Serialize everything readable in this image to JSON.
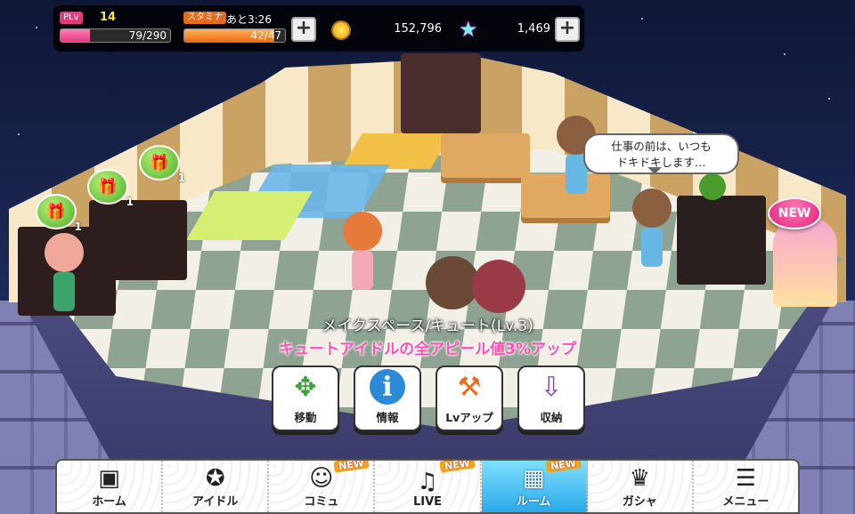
{
  "hud": {
    "plv_label": "PLv",
    "plv_value": "14",
    "exp_text": "79/290",
    "exp_fraction": 0.27,
    "stamina_label": "スタミナ",
    "stamina_timer": "あと3:26",
    "stamina_text": "42/47",
    "stamina_fraction": 0.89,
    "money": "152,796",
    "jewels": "1,469",
    "plus_symbol": "+"
  },
  "room": {
    "speech": "仕事の前は、いつも\nドキドキします…",
    "new_badge": "NEW",
    "gift_counts": [
      "1",
      "1",
      "1"
    ],
    "gift_icon": "gift-icon"
  },
  "item": {
    "name": "メイクスペース/キュート(Lv.3)",
    "effect": "キュートアイドルの全アピール値3%アップ"
  },
  "actions": [
    {
      "label": "移動",
      "icon": "move-arrows-icon",
      "glyph": "✥"
    },
    {
      "label": "情報",
      "icon": "info-icon",
      "glyph": "i"
    },
    {
      "label": "Lvアップ",
      "icon": "hammer-icon",
      "glyph": "⚒"
    },
    {
      "label": "収納",
      "icon": "storage-cart-icon",
      "glyph": "⇩"
    }
  ],
  "nav": {
    "items": [
      {
        "label": "ホーム",
        "icon": "speaker-home-icon",
        "glyph": "▣",
        "new": false
      },
      {
        "label": "アイドル",
        "icon": "idol-star-icon",
        "glyph": "✪",
        "new": false
      },
      {
        "label": "コミュ",
        "icon": "chat-icon",
        "glyph": "☺",
        "new": true
      },
      {
        "label": "LIVE",
        "icon": "music-note-icon",
        "glyph": "♫",
        "new": true
      },
      {
        "label": "ルーム",
        "icon": "room-cube-icon",
        "glyph": "▦",
        "new": true
      },
      {
        "label": "ガシャ",
        "icon": "crown-icon",
        "glyph": "♛",
        "new": false
      },
      {
        "label": "メニュー",
        "icon": "menu-icon",
        "glyph": "☰",
        "new": false
      }
    ],
    "new_label": "NEW"
  }
}
